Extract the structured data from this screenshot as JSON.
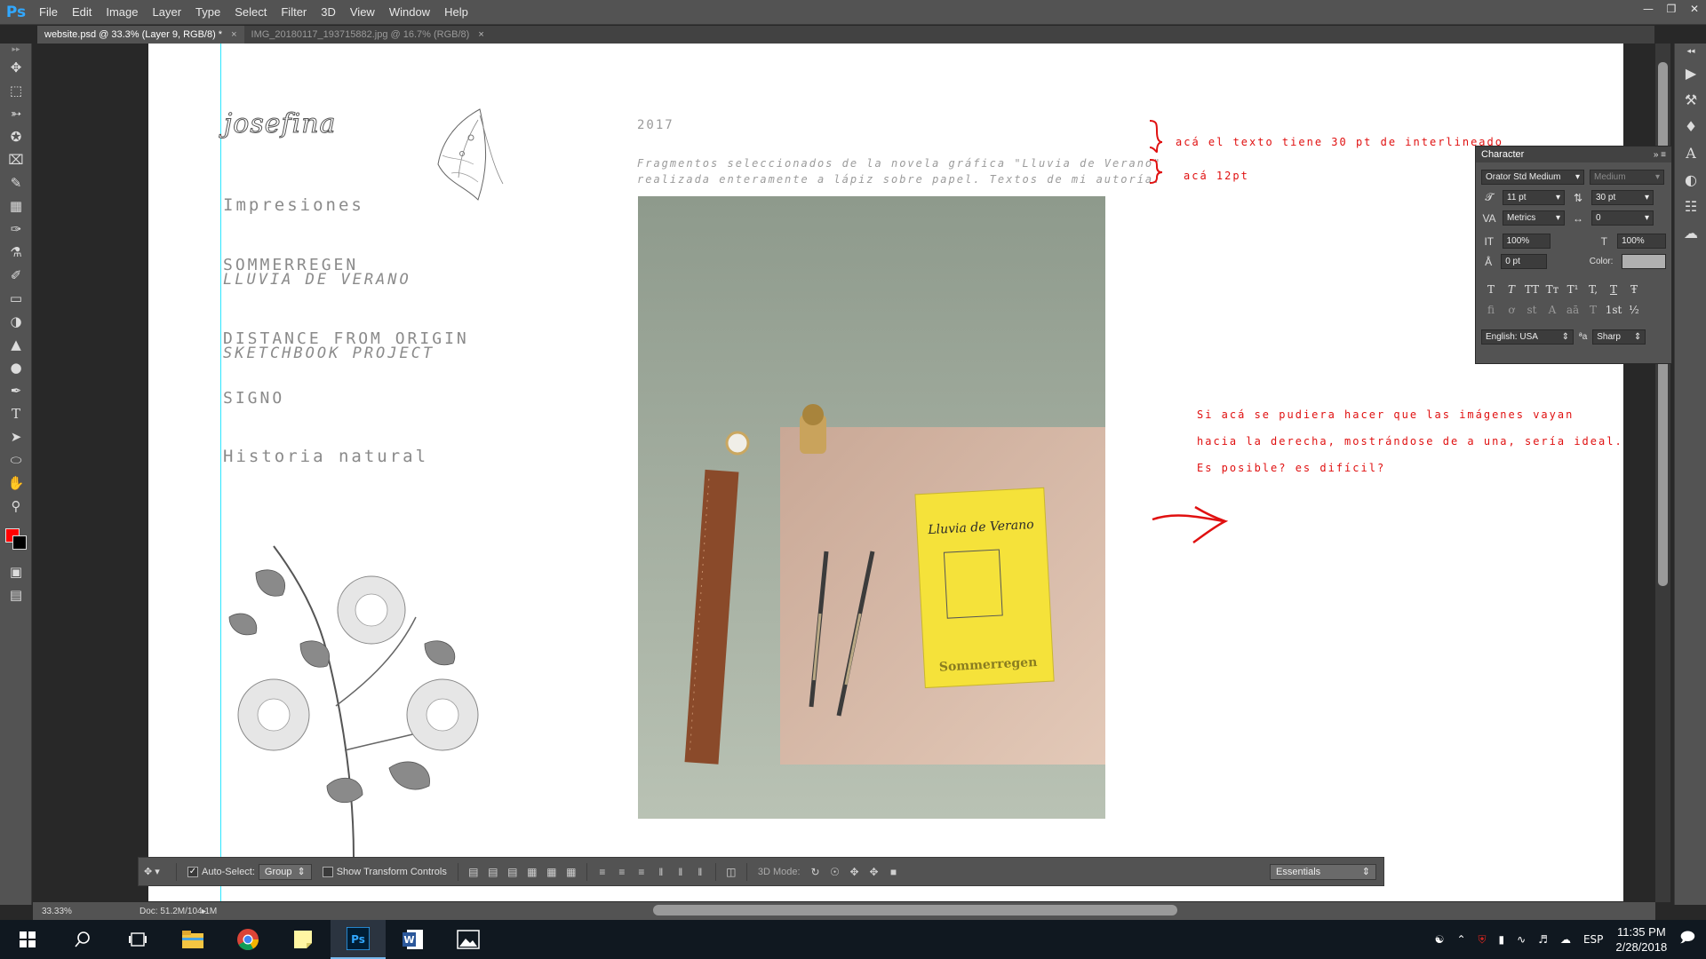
{
  "app": {
    "logo": "Ps",
    "menus": [
      "File",
      "Edit",
      "Image",
      "Layer",
      "Type",
      "Select",
      "Filter",
      "3D",
      "View",
      "Window",
      "Help"
    ]
  },
  "tabs": [
    {
      "label": "website.psd @ 33.3% (Layer 9, RGB/8) *",
      "close": "×",
      "active": true
    },
    {
      "label": "IMG_20180117_193715882.jpg @ 16.7% (RGB/8)",
      "close": "×",
      "active": false
    }
  ],
  "page": {
    "logo": "josefina",
    "nav": {
      "impresiones": "Impresiones",
      "sommerregen": "SOMMERREGEN",
      "lluvia": "LLUVIA DE VERANO",
      "distance": "DISTANCE FROM ORIGIN",
      "sketchbook": "SKETCHBOOK PROJECT",
      "signo": "SIGNO",
      "historia": "Historia natural"
    },
    "year": "2017",
    "desc_line1": "Fragmentos seleccionados de la novela gráfica \"Lluvia de Verano\"",
    "desc_line2": "realizada enteramente a lápiz sobre papel. Textos de mi autoría.",
    "book_title": "Lluvia de Verano",
    "book_subtitle": "Sommerregen"
  },
  "annotations": {
    "leading_note": "acá el texto tiene 30 pt de interlineado",
    "size_note": "acá 12pt",
    "idea_line1": "Si acá se pudiera hacer que las imágenes vayan",
    "idea_line2": "hacia la derecha, mostrándose de a una, sería ideal.",
    "idea_line3": "Es posible? es difícil?"
  },
  "character_panel": {
    "title": "Character",
    "font_family": "Orator Std Medium",
    "font_style": "Medium",
    "font_size": "11 pt",
    "leading": "30 pt",
    "kerning": "Metrics",
    "tracking": "0",
    "vertical_scale": "100%",
    "horizontal_scale": "100%",
    "baseline_shift": "0 pt",
    "color_label": "Color:",
    "styles": [
      "T",
      "T",
      "TT",
      "Tт",
      "T¹",
      "T,",
      "T",
      "Ŧ"
    ],
    "opentype": [
      "fi",
      "ơ",
      "st",
      "A",
      "aā",
      "T",
      "1st",
      "½"
    ],
    "language": "English: USA",
    "aa_label": "ªa",
    "antialias": "Sharp"
  },
  "options_bar": {
    "auto_select_label": "Auto-Select:",
    "auto_select_value": "Group",
    "show_transform_label": "Show Transform Controls",
    "mode_3d_label": "3D Mode:",
    "workspace": "Essentials"
  },
  "status": {
    "zoom": "33.33%",
    "doc": "Doc: 51.2M/104.1M"
  },
  "taskbar": {
    "time": "11:35 PM",
    "date": "2/28/2018",
    "lang": "ESP"
  },
  "colors": {
    "annotation": "#e01010",
    "guide": "#2ee6ff",
    "foreground": "#ff0000",
    "background": "#000000",
    "book_cover": "#f5e23a"
  }
}
